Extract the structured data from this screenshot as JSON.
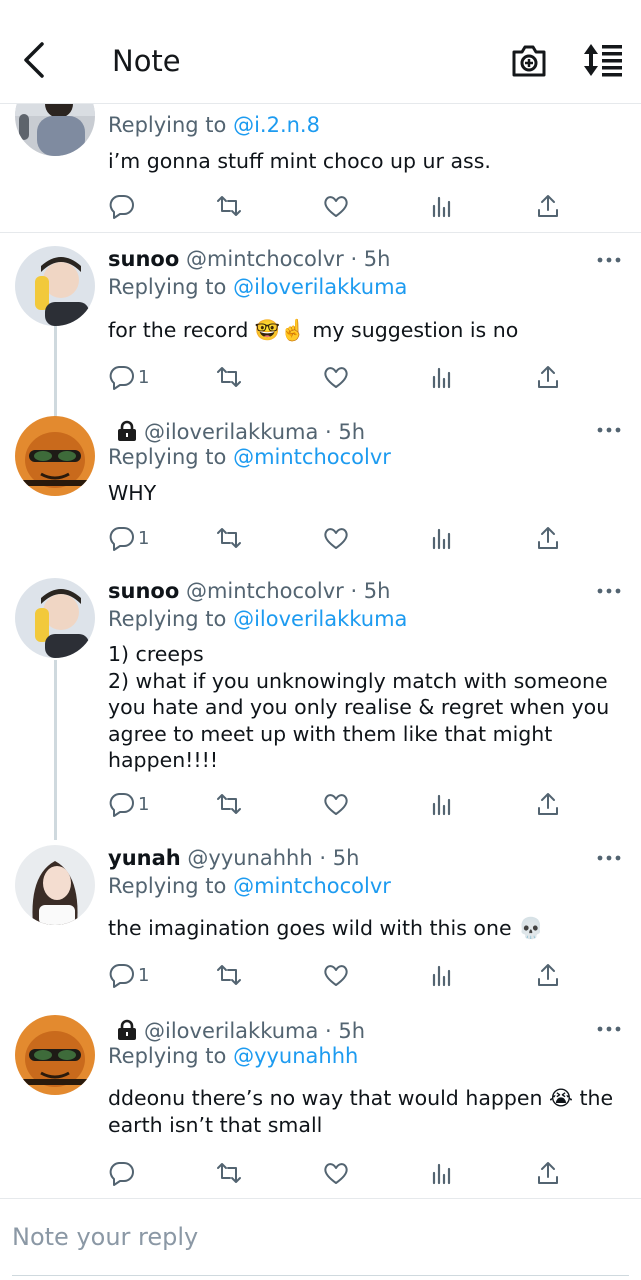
{
  "header": {
    "title": "Note"
  },
  "tweets": [
    {
      "reply_prefix": "Replying to ",
      "reply_handle": "@i.2.n.8",
      "text": "i’m gonna stuff mint choco up ur ass.",
      "replies": "",
      "avatar": "avatar-girl-sitting"
    },
    {
      "name": "sunoo",
      "handle": "@mintchocolvr",
      "time": " · 5h",
      "reply_prefix": "Replying to ",
      "reply_handle": "@iloverilakkuma",
      "text": "for the record 🤓☝️ my suggestion is no",
      "replies": "1"
    },
    {
      "name": "",
      "handle": "@iloverilakkuma",
      "time": " · 5h",
      "reply_prefix": "Replying to ",
      "reply_handle": "@mintchocolvr",
      "text": "WHY",
      "replies": "1"
    },
    {
      "name": "sunoo",
      "handle": "@mintchocolvr",
      "time": " · 5h",
      "reply_prefix": "Replying to ",
      "reply_handle": "@iloverilakkuma",
      "text": "1) creeps\n2) what if you unknowingly match with someone you hate and you only realise & regret when you agree to meet up with them like that might happen!!!!",
      "replies": "1"
    },
    {
      "name": "yunah",
      "handle": "@yyunahhh",
      "time": " · 5h",
      "reply_prefix": "Replying to ",
      "reply_handle": "@mintchocolvr",
      "text": "the imagination goes wild with this one 💀",
      "replies": "1"
    },
    {
      "name": "",
      "handle": "@iloverilakkuma",
      "time": " · 5h",
      "reply_prefix": "Replying to ",
      "reply_handle": "@yyunahhh",
      "text": "ddeonu there’s no way that would happen 😭 the earth isn’t that small",
      "replies": ""
    }
  ],
  "composer": {
    "placeholder": "Note your reply"
  },
  "colors": {
    "accent": "#1d9bf0",
    "muted": "#536471",
    "text": "#0f1419",
    "divider": "#e6e9ec"
  }
}
